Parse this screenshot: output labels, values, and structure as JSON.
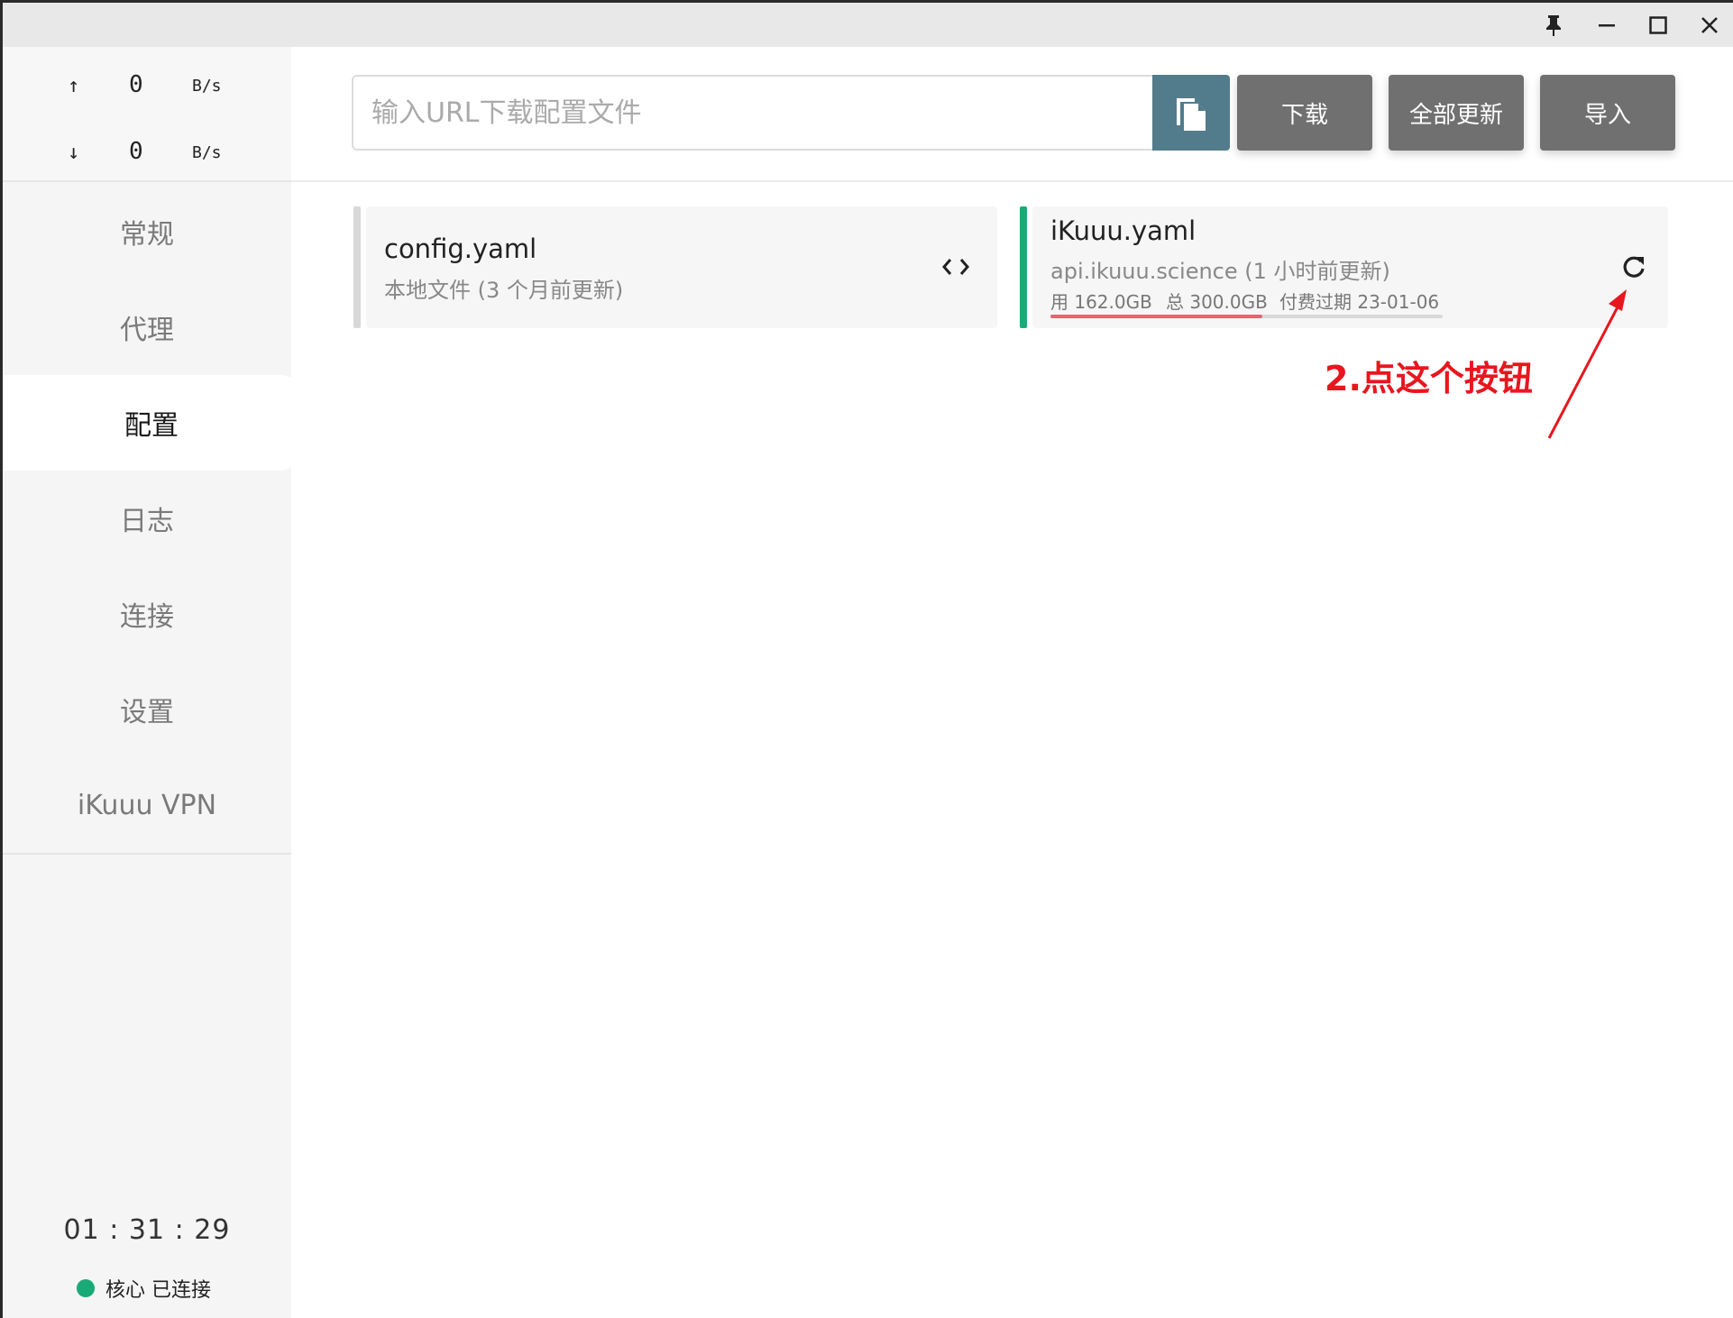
{
  "titlebar": {
    "buttons": [
      "pin-icon",
      "minimize-icon",
      "maximize-icon",
      "close-icon"
    ]
  },
  "traffic": {
    "up_arrow": "↑",
    "up_value": "0",
    "up_unit": "B/s",
    "down_arrow": "↓",
    "down_value": "0",
    "down_unit": "B/s"
  },
  "nav": {
    "items": [
      "常规",
      "代理",
      "配置",
      "日志",
      "连接",
      "设置",
      "iKuuu VPN"
    ],
    "active": "配置"
  },
  "footer": {
    "uptime": "01 : 31 : 29",
    "status": "核心 已连接",
    "status_color": "#1aaa78"
  },
  "toolbar": {
    "url_placeholder": "输入URL下载配置文件",
    "download_label": "下载",
    "update_all_label": "全部更新",
    "import_label": "导入"
  },
  "profiles": [
    {
      "name": "config.yaml",
      "source": "本地文件 (3 个月前更新)",
      "active": false,
      "action_icon": "code-icon"
    },
    {
      "name": "iKuuu.yaml",
      "source": "api.ikuuu.science (1 小时前更新)",
      "used": "用 162.0GB",
      "total": "总 300.0GB",
      "expire": "付费过期 23-01-06",
      "usage_fraction": 0.54,
      "active": true,
      "accent_color": "#1aaa78",
      "action_icon": "refresh-icon"
    }
  ],
  "annotation": {
    "text": "2.点这个按钮",
    "color": "#e8161e"
  }
}
